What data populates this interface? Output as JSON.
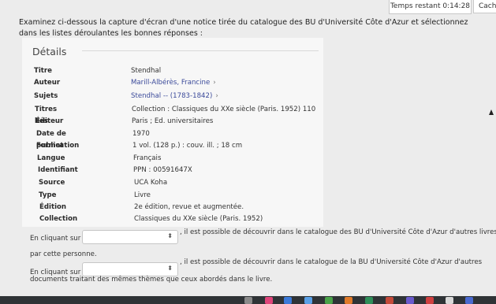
{
  "top_bar": {
    "timer_label": "Temps restant 0:14:28",
    "hide_label": "Cache"
  },
  "question": {
    "text": "Examinez ci-dessous la capture d'écran d'une notice tirée du catalogue des BU d'Université Côte d'Azur et sélectionnez dans les listes déroulantes les bonnes réponses :"
  },
  "record": {
    "title": "Détails",
    "rows": [
      {
        "label": "Titre",
        "value": "Stendhal"
      },
      {
        "label": "Auteur",
        "value": "Marill-Albérès, Francine",
        "chevron": "›"
      },
      {
        "label": "Sujets",
        "value": "Stendhal -- (1783-1842)",
        "chevron": "›"
      },
      {
        "label": "Titres liés",
        "value": "Collection : Classiques du XXe siècle (Paris. 1952) 110"
      },
      {
        "label": "Éditeur",
        "value": "Paris ; Ed. universitaires"
      },
      {
        "label": "Date de publication",
        "value": "1970"
      },
      {
        "label": "Format",
        "value": "1 vol. (128 p.) : couv. ill. ; 18 cm"
      },
      {
        "label": "Langue",
        "value": "Français"
      },
      {
        "label": "Identifiant",
        "value": "PPN : 00591647X"
      },
      {
        "label": "Source",
        "value": "UCA Koha"
      },
      {
        "label": "Type",
        "value": "Livre"
      },
      {
        "label": "Édition",
        "value": "2e édition, revue et augmentée."
      },
      {
        "label": "Collection",
        "value": "Classiques du XXe siècle (Paris. 1952)"
      }
    ]
  },
  "q1": {
    "prefix": "En cliquant sur",
    "suffix": ", il est possible de découvrir dans le catalogue des BU d'Université Côte d'Azur d'autres livres écrits",
    "cont": "par cette personne."
  },
  "q2": {
    "prefix": "En cliquant sur",
    "suffix": ", il est possible de découvrir dans le catalogue de la BU d'Université Côte d'Azur d'autres",
    "cont": "documents traitant des mêmes thèmes que ceux abordés dans le livre."
  },
  "select_arrows_glyph": "⬍",
  "colors": {
    "link": "#3b4a9a",
    "card_bg": "#f7f7f7",
    "page_bg": "#ececec",
    "dock_bg": "#2f3336"
  }
}
